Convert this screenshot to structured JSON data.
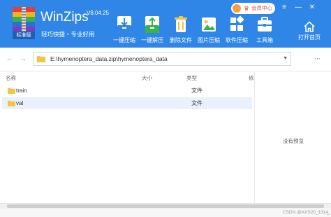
{
  "app": {
    "name": "WinZips",
    "version": "V8.04.25",
    "edition_tag": "标准版",
    "slogan": "轻巧快捷・专业好用"
  },
  "toolbar": [
    {
      "label": "一键压缩",
      "icon": "compress-icon"
    },
    {
      "label": "一键解压",
      "icon": "extract-icon"
    },
    {
      "label": "删除文件",
      "icon": "delete-file-icon"
    },
    {
      "label": "图片压缩",
      "icon": "image-compress-icon"
    },
    {
      "label": "软件压缩",
      "icon": "software-compress-icon"
    },
    {
      "label": "工具箱",
      "icon": "toolbox-icon"
    }
  ],
  "vip": {
    "label": "会员中心"
  },
  "window_controls": {
    "menu": "≡",
    "minimize": "—",
    "close": "✕"
  },
  "open_home": {
    "label": "打开首页"
  },
  "address": {
    "path": "E:\\hymenoptera_data.zip\\hymenoptera_data"
  },
  "columns": {
    "name": "名称",
    "size": "大小",
    "type": "类型",
    "modified": "修"
  },
  "files": [
    {
      "name": "train",
      "type": "文件"
    },
    {
      "name": "val",
      "type": "文件"
    }
  ],
  "preview": {
    "empty_text": "没有预览"
  },
  "watermark": "CSDN @AXS20_1314̲̲",
  "colors": {
    "header": "#2f86e6",
    "selected_row": "#e9f1fc",
    "folder": "#f6c343"
  }
}
